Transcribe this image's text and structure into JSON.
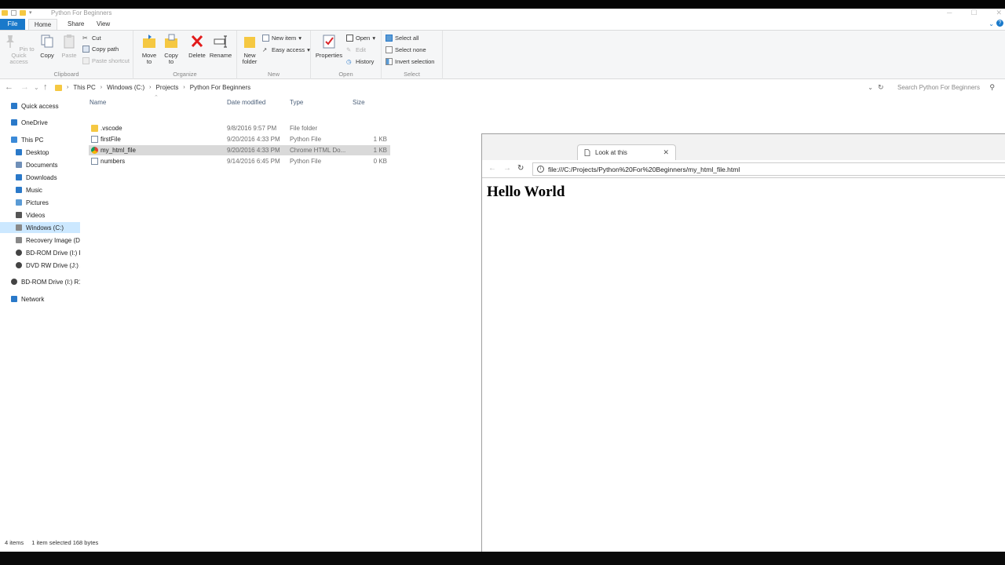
{
  "explorer": {
    "window_title": "Python For Beginners",
    "tabs": [
      "File",
      "Home",
      "Share",
      "View"
    ],
    "ribbon": {
      "clipboard": {
        "label": "Clipboard",
        "pin": "Pin to Quick access",
        "copy": "Copy",
        "paste": "Paste",
        "cut": "Cut",
        "copy_path": "Copy path",
        "paste_shortcut": "Paste shortcut"
      },
      "organize": {
        "label": "Organize",
        "move_to": "Move to",
        "copy_to": "Copy to",
        "delete": "Delete",
        "rename": "Rename"
      },
      "new": {
        "label": "New",
        "new_folder": "New folder",
        "new_item": "New item",
        "easy_access": "Easy access"
      },
      "open": {
        "label": "Open",
        "properties": "Properties",
        "open": "Open",
        "edit": "Edit",
        "history": "History"
      },
      "select": {
        "label": "Select",
        "select_all": "Select all",
        "select_none": "Select none",
        "invert": "Invert selection"
      }
    },
    "breadcrumb": [
      "This PC",
      "Windows (C:)",
      "Projects",
      "Python For Beginners"
    ],
    "search_placeholder": "Search Python For Beginners",
    "nav": [
      {
        "label": "Quick access",
        "icon": "star-icon",
        "color": "#2a79c9"
      },
      {
        "label": "OneDrive",
        "icon": "cloud-icon",
        "color": "#2a79c9"
      },
      {
        "label": "This PC",
        "icon": "computer-icon",
        "color": "#3b8ad8"
      },
      {
        "label": "Desktop",
        "icon": "desktop-icon",
        "color": "#2a79c9"
      },
      {
        "label": "Documents",
        "icon": "documents-icon",
        "color": "#6f8fb8"
      },
      {
        "label": "Downloads",
        "icon": "download-icon",
        "color": "#2a79c9"
      },
      {
        "label": "Music",
        "icon": "music-icon",
        "color": "#2a79c9"
      },
      {
        "label": "Pictures",
        "icon": "pictures-icon",
        "color": "#5a9bd5"
      },
      {
        "label": "Videos",
        "icon": "videos-icon",
        "color": "#555"
      },
      {
        "label": "Windows (C:)",
        "icon": "drive-icon",
        "color": "#888"
      },
      {
        "label": "Recovery Image (D:",
        "icon": "drive-icon",
        "color": "#888"
      },
      {
        "label": "BD-ROM Drive (I:) F",
        "icon": "disc-icon",
        "color": "#444"
      },
      {
        "label": "DVD RW Drive (J:) A",
        "icon": "disc-icon",
        "color": "#444"
      },
      {
        "label": "BD-ROM Drive (I:) R1",
        "icon": "disc-icon",
        "color": "#444"
      },
      {
        "label": "Network",
        "icon": "network-icon",
        "color": "#2a79c9"
      }
    ],
    "columns": {
      "name": "Name",
      "date": "Date modified",
      "type": "Type",
      "size": "Size"
    },
    "files": [
      {
        "name": ".vscode",
        "date": "9/8/2016 9:57 PM",
        "type": "File folder",
        "size": "",
        "icon": "folder-icon"
      },
      {
        "name": "firstFile",
        "date": "9/20/2016 4:33 PM",
        "type": "Python File",
        "size": "1 KB",
        "icon": "python-file-icon"
      },
      {
        "name": "my_html_file",
        "date": "9/20/2016 4:33 PM",
        "type": "Chrome HTML Do...",
        "size": "1 KB",
        "icon": "chrome-icon"
      },
      {
        "name": "numbers",
        "date": "9/14/2016 6:45 PM",
        "type": "Python File",
        "size": "0 KB",
        "icon": "python-file-icon"
      }
    ],
    "status": {
      "count": "4 items",
      "selection": "1 item selected  168 bytes"
    }
  },
  "chrome": {
    "tab_title": "Look at this",
    "url": "file:///C:/Projects/Python%20For%20Beginners/my_html_file.html",
    "heading": "Hello World"
  },
  "colors": {
    "accent": "#1979ca",
    "folder": "#f5c842"
  }
}
